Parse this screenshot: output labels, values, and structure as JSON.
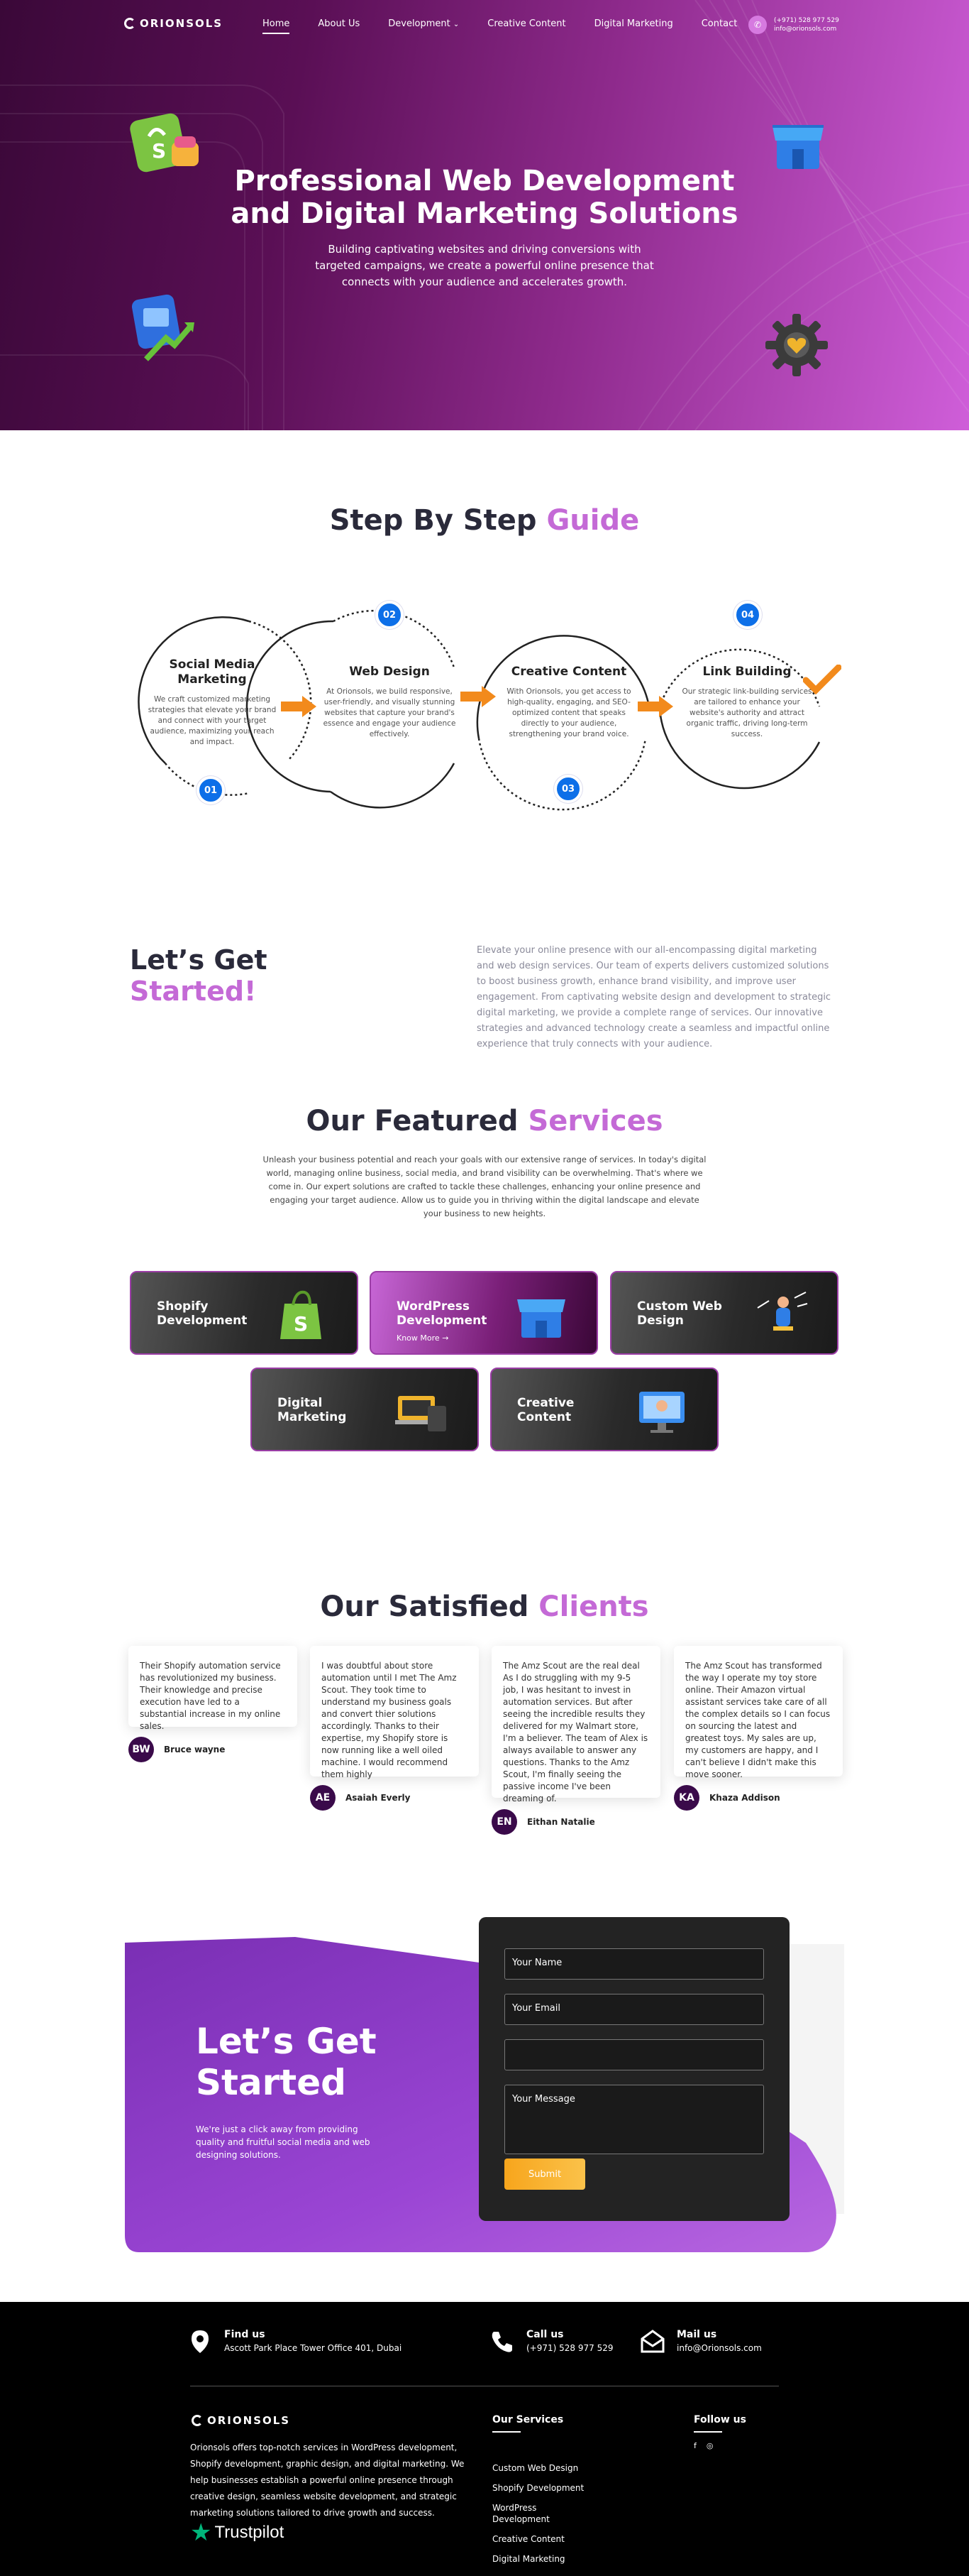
{
  "nav": {
    "logo": "ORIONSOLS",
    "items": [
      {
        "label": "Home"
      },
      {
        "label": "About Us"
      },
      {
        "label": "Development"
      },
      {
        "label": "Creative Content"
      },
      {
        "label": "Digital Marketing"
      },
      {
        "label": "Contact"
      }
    ],
    "phone": "(+971) 528 977 529",
    "email": "info@orionsols.com"
  },
  "hero": {
    "title_line1": "Professional Web Development",
    "title_line2": "and Digital Marketing Solutions",
    "subtitle": "Building captivating websites and driving conversions with targeted campaigns, we create a powerful online presence that connects with your audience and accelerates growth."
  },
  "guide": {
    "title_a": "Step By Step",
    "title_b": "Guide",
    "steps": [
      {
        "num": "01",
        "title": "Social Media Marketing",
        "text": "We craft customized marketing strategies that elevate your brand and connect with your target audience, maximizing your reach and impact."
      },
      {
        "num": "02",
        "title": "Web Design",
        "text": "At Orionsols, we build responsive, user-friendly, and visually stunning websites that capture your brand's essence and engage your audience effectively."
      },
      {
        "num": "03",
        "title": "Creative Content",
        "text": "With Orionsols, you get access to high-quality, engaging, and SEO-optimized content that speaks directly to your audience, strengthening your brand voice."
      },
      {
        "num": "04",
        "title": "Link Building",
        "text": "Our strategic link-building services are tailored to enhance your website's authority and attract organic traffic, driving long-term success."
      }
    ]
  },
  "intro": {
    "title_a": "Let’s Get",
    "title_b": "Started!",
    "text": "Elevate your online presence with our all-encompassing digital marketing and web design services. Our team of experts delivers customized solutions to boost business growth, enhance brand visibility, and improve user engagement. From captivating website design and development to strategic digital marketing, we provide a complete range of services. Our innovative strategies and advanced technology create a seamless and impactful online experience that truly connects with your audience."
  },
  "services": {
    "title_a": "Our Featured",
    "title_b": "Services",
    "text": "Unleash your business potential and reach your goals with our extensive range of services. In today's digital world, managing online business, social media, and brand visibility can be overwhelming. That's where we come in. Our expert solutions are crafted to tackle these challenges, enhancing your online presence and engaging your target audience. Allow us to guide you in thriving within the digital landscape and elevate your business to new heights.",
    "cards": [
      {
        "title": "Shopify Development"
      },
      {
        "title": "WordPress Development",
        "link": "Know More"
      },
      {
        "title": "Custom Web Design"
      },
      {
        "title": "Digital Marketing"
      },
      {
        "title": "Creative Content"
      }
    ]
  },
  "clients": {
    "title_a": "Our Satisfied",
    "title_b": "Clients",
    "items": [
      {
        "text": "Their Shopify automation service has revolutionized my business. Their knowledge and precise execution have led to a substantial increase in my online sales.",
        "initials": "BW",
        "name": "Bruce wayne"
      },
      {
        "text": "I was doubtful about store automation until I met The Amz Scout. They took time to understand my business goals and convert thier solutions accordingly. Thanks to their expertise, my Shopify store is now running like a well oiled machine. I would recommend them highly",
        "initials": "AE",
        "name": "Asaiah Everly"
      },
      {
        "text": "The Amz Scout are the real deal As I do struggling with my 9-5 job, I was hesitant to invest in automation services. But after seeing the incredible results they delivered for my Walmart store, I'm a believer. The team of Alex is always available to answer any questions. Thanks to the Amz Scout, I'm finally seeing the passive income I've been dreaming of.",
        "initials": "EN",
        "name": "Eithan Natalie"
      },
      {
        "text": "The Amz Scout has transformed the way I operate my toy store online. Their Amazon virtual assistant services take care of all the complex details so I can focus on sourcing the latest and greatest toys. My sales are up, my customers are happy, and I can't believe I didn't make this move sooner.",
        "initials": "KA",
        "name": "Khaza Addison"
      }
    ]
  },
  "cta": {
    "title_line1": "Let’s Get",
    "title_line2": "Started",
    "text": "We're just a click away from providing quality and fruitful social media and web designing solutions.",
    "form": {
      "name_placeholder": "Your Name",
      "email_placeholder": "Your Email",
      "phone_placeholder": "",
      "message_placeholder": "Your Message",
      "submit": "Submit"
    }
  },
  "footer": {
    "find_title": "Find us",
    "find_text": "Ascott Park Place Tower Office 401, Dubai",
    "call_title": "Call us",
    "call_text": "(+971) 528 977 529",
    "mail_title": "Mail us",
    "mail_text": "info@Orionsols.com",
    "logo": "ORIONSOLS",
    "desc": "Orionsols offers top-notch services in WordPress development, Shopify development, graphic design, and digital marketing. We help businesses establish a powerful online presence through creative design, seamless website development, and strategic marketing solutions tailored to drive growth and success.",
    "trustpilot": "Trustpilot",
    "services_title": "Our Services",
    "services": [
      "Custom Web Design",
      "Shopify Development",
      "WordPress Development",
      "Creative Content",
      "Digital Marketing"
    ],
    "follow_title": "Follow us",
    "social": [
      "f",
      "◎"
    ]
  },
  "colors": {
    "accent": "#c46ad6",
    "blue": "#0d6fe8",
    "orange": "#f28a1c",
    "dark": "#2a2a3a"
  }
}
